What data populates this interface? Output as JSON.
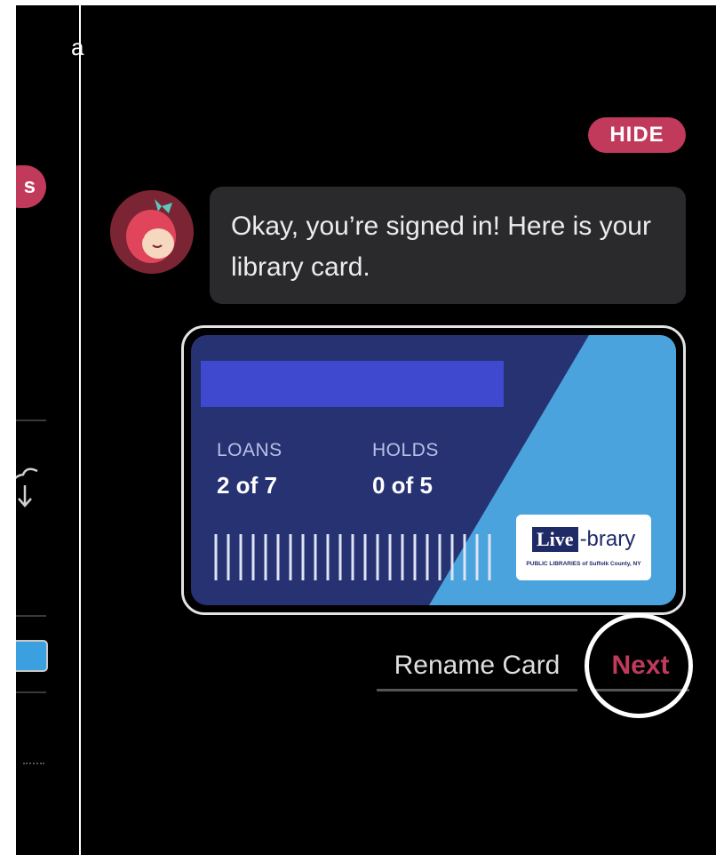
{
  "side": {
    "pill_label": "s",
    "stray_glyph": "a"
  },
  "chat": {
    "hide_label": "HIDE",
    "message": "Okay, you’re signed in! Here is your library card."
  },
  "card": {
    "loans_label": "LOANS",
    "loans_value": "2 of 7",
    "holds_label": "HOLDS",
    "holds_value": "0 of 5",
    "logo_word1": "Live",
    "logo_word2": "-brary",
    "logo_subtitle": "PUBLIC LIBRARIES of Suffolk County, NY",
    "colors": {
      "base": "#263272",
      "accent": "#4aa3dc",
      "name_bar": "#3f49cf"
    }
  },
  "actions": {
    "rename_label": "Rename Card",
    "next_label": "Next"
  },
  "colors": {
    "brand": "#c1395b",
    "background": "#000000",
    "bubble": "#2a2a2c"
  }
}
